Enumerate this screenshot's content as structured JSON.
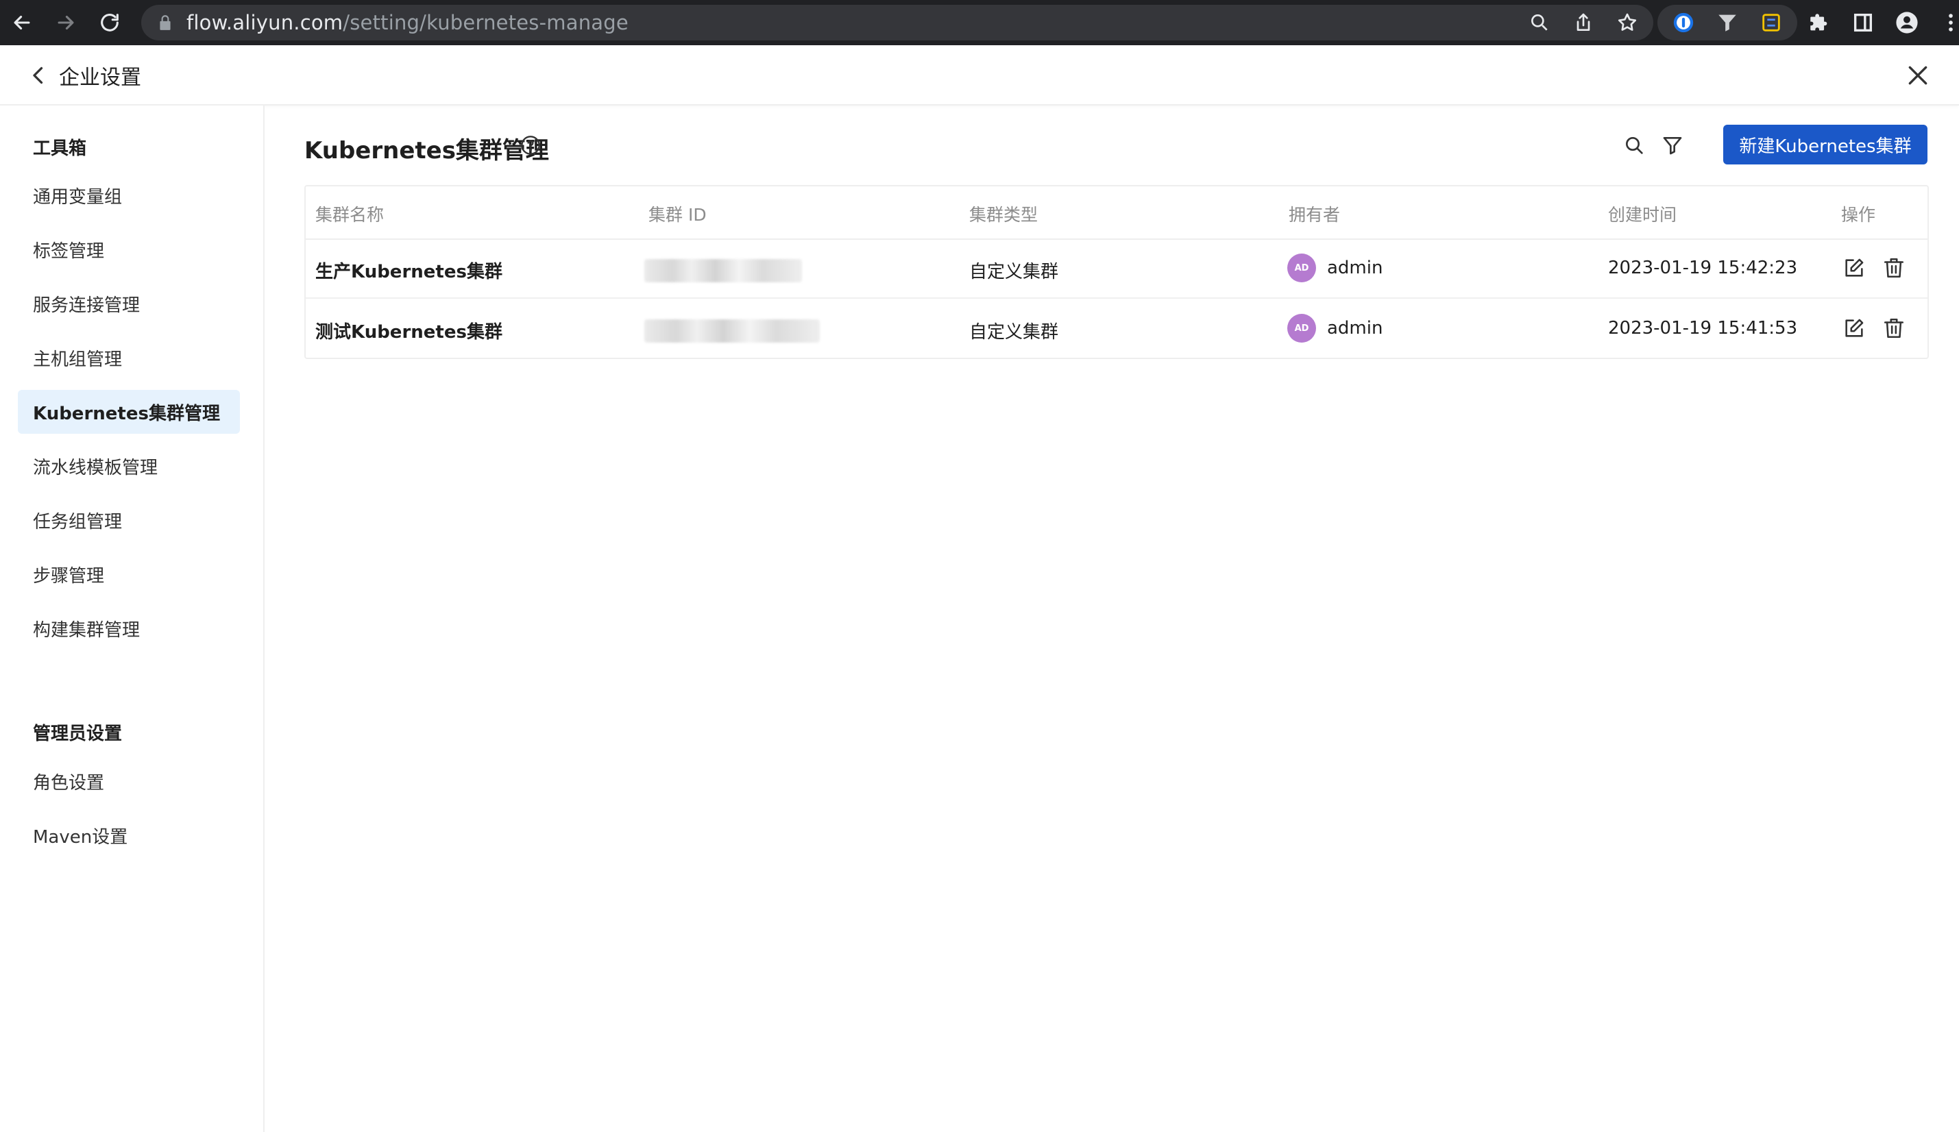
{
  "browser": {
    "url_host": "flow.aliyun.com",
    "url_path": "/setting/kubernetes-manage"
  },
  "header": {
    "title": "企业设置"
  },
  "sidebar": {
    "groups": [
      {
        "title": "工具箱",
        "items": [
          {
            "label": "通用变量组"
          },
          {
            "label": "标签管理"
          },
          {
            "label": "服务连接管理"
          },
          {
            "label": "主机组管理"
          },
          {
            "label": "Kubernetes集群管理",
            "active": true
          },
          {
            "label": "流水线模板管理"
          },
          {
            "label": "任务组管理"
          },
          {
            "label": "步骤管理"
          },
          {
            "label": "构建集群管理"
          }
        ]
      },
      {
        "title": "管理员设置",
        "items": [
          {
            "label": "角色设置"
          },
          {
            "label": "Maven设置"
          }
        ]
      }
    ]
  },
  "main": {
    "title": "Kubernetes集群管理",
    "create_button": "新建Kubernetes集群",
    "table": {
      "columns": [
        "集群名称",
        "集群 ID",
        "集群类型",
        "拥有者",
        "创建时间",
        "操作"
      ],
      "rows": [
        {
          "name": "生产Kubernetes集群",
          "cluster_id": "",
          "type": "自定义集群",
          "owner": "admin",
          "avatar_initials": "AD",
          "created": "2023-01-19 15:42:23"
        },
        {
          "name": "测试Kubernetes集群",
          "cluster_id": "",
          "type": "自定义集群",
          "owner": "admin",
          "avatar_initials": "AD",
          "created": "2023-01-19 15:41:53"
        }
      ]
    }
  },
  "colors": {
    "primary": "#1b58c8",
    "active_bg": "#e6f2fd",
    "avatar": "#b57bd0",
    "chrome_bg": "#202124"
  },
  "icons": {
    "back": "arrow-left-icon",
    "forward": "arrow-right-icon",
    "reload": "reload-icon",
    "lock": "lock-icon",
    "help": "question-circle-icon",
    "search": "search-icon",
    "filter": "filter-icon",
    "edit": "edit-icon",
    "delete": "trash-icon",
    "close": "close-icon"
  }
}
